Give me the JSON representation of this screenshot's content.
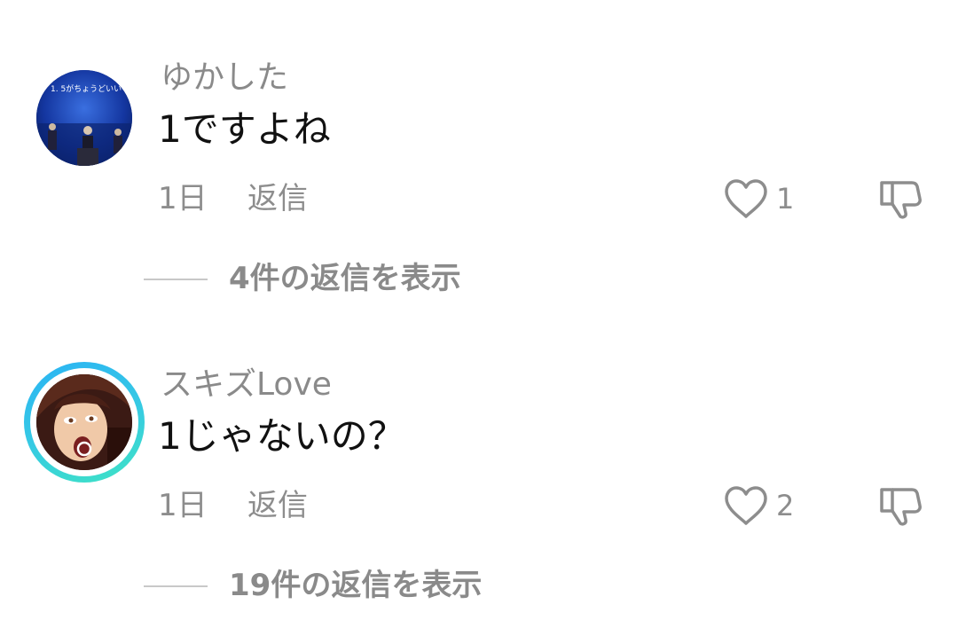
{
  "comments": [
    {
      "username": "ゆかした",
      "text": "1ですよね",
      "timestamp": "1日",
      "reply_label": "返信",
      "like_count": "1",
      "view_replies_label": "4件の返信を表示",
      "avatar_caption": "1. 5がちょうどいい"
    },
    {
      "username": "スキズLove",
      "text": "1じゃないの？",
      "timestamp": "1日",
      "reply_label": "返信",
      "like_count": "2",
      "view_replies_label": "19件の返信を表示"
    }
  ],
  "colors": {
    "meta_text": "#8d8d8d",
    "body_text": "#111111",
    "ring_start": "#2ab3f4",
    "ring_end": "#3fe3c4"
  },
  "icons": {
    "like": "heart-outline-icon",
    "dislike": "thumbs-down-outline-icon"
  }
}
